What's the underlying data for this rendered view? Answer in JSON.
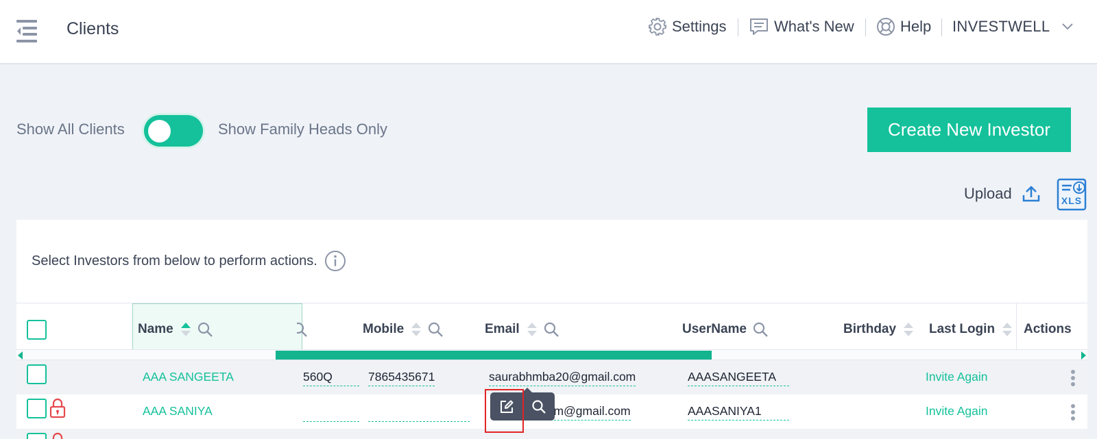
{
  "header": {
    "title": "Clients",
    "settings_label": "Settings",
    "whats_new_label": "What's New",
    "help_label": "Help",
    "user_label": "INVESTWELL"
  },
  "filters": {
    "left_label": "Show All Clients",
    "right_label": "Show Family Heads Only",
    "toggle_on": true
  },
  "actions": {
    "create_label": "Create New Investor",
    "upload_label": "Upload",
    "xls_label": "XLS"
  },
  "panel": {
    "instruction": "Select Investors from below to perform actions."
  },
  "table": {
    "columns": {
      "name": "Name",
      "mobile": "Mobile",
      "email": "Email",
      "username": "UserName",
      "birthday": "Birthday",
      "last_login": "Last Login",
      "actions": "Actions"
    },
    "scroll_position": 0.3,
    "rows": [
      {
        "name": "AAA SANGEETA",
        "pan": "560Q",
        "mobile": "7865435671",
        "email": "saurabhmba20@gmail.com",
        "username": "AAASANGEETA",
        "last_login": "Invite Again",
        "locked": false
      },
      {
        "name": "AAA SANIYA",
        "pan": "",
        "mobile": "",
        "email": "num@gmail.com",
        "username": "AAASANIYA1",
        "last_login": "Invite Again",
        "locked": true
      }
    ]
  },
  "colors": {
    "accent": "#14c19b",
    "lock": "#e5484d",
    "highlight": "#e02424"
  }
}
